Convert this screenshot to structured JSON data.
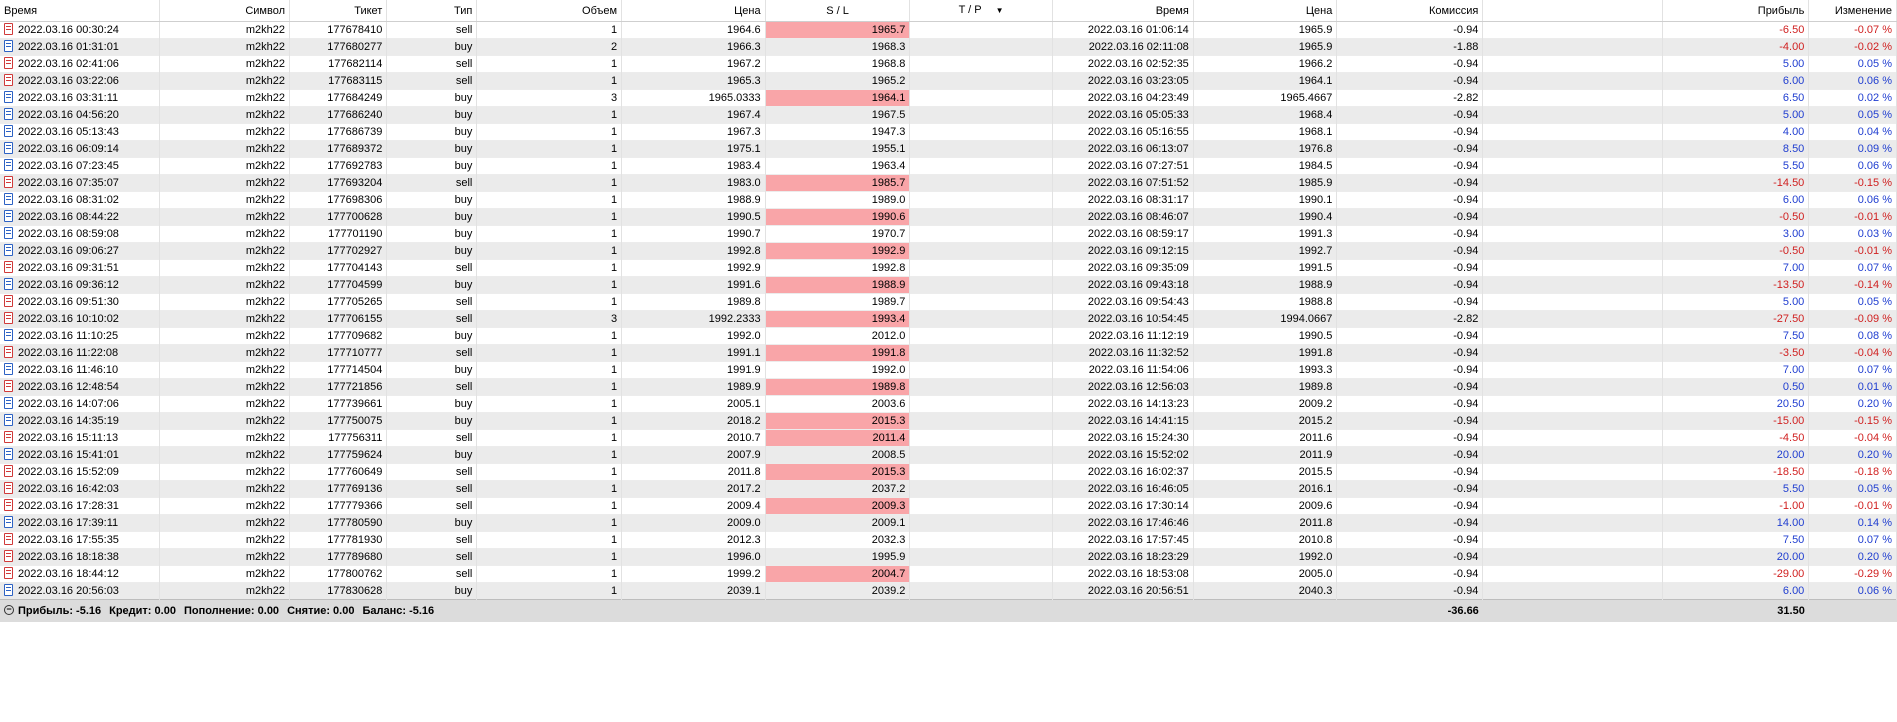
{
  "columns": [
    "Время",
    "Символ",
    "Тикет",
    "Тип",
    "Объем",
    "Цена",
    "S / L",
    "T / P",
    "Время",
    "Цена",
    "Комиссия",
    "",
    "Прибыль",
    "Изменение"
  ],
  "tp_sort_icon": "▼",
  "rows": [
    {
      "open_time": "2022.03.16 00:30:24",
      "symbol": "m2kh22",
      "ticket": "177678410",
      "type": "sell",
      "volume": "1",
      "price": "1964.6",
      "sl": "1965.7",
      "sl_hl": true,
      "tp": "",
      "close_time": "2022.03.16 01:06:14",
      "close_price": "1965.9",
      "commission": "-0.94",
      "profit": "-6.50",
      "change": "-0.07 %"
    },
    {
      "open_time": "2022.03.16 01:31:01",
      "symbol": "m2kh22",
      "ticket": "177680277",
      "type": "buy",
      "volume": "2",
      "price": "1966.3",
      "sl": "1968.3",
      "sl_hl": false,
      "tp": "",
      "close_time": "2022.03.16 02:11:08",
      "close_price": "1965.9",
      "commission": "-1.88",
      "profit": "-4.00",
      "change": "-0.02 %"
    },
    {
      "open_time": "2022.03.16 02:41:06",
      "symbol": "m2kh22",
      "ticket": "177682114",
      "type": "sell",
      "volume": "1",
      "price": "1967.2",
      "sl": "1968.8",
      "sl_hl": false,
      "tp": "",
      "close_time": "2022.03.16 02:52:35",
      "close_price": "1966.2",
      "commission": "-0.94",
      "profit": "5.00",
      "change": "0.05 %"
    },
    {
      "open_time": "2022.03.16 03:22:06",
      "symbol": "m2kh22",
      "ticket": "177683115",
      "type": "sell",
      "volume": "1",
      "price": "1965.3",
      "sl": "1965.2",
      "sl_hl": false,
      "tp": "",
      "close_time": "2022.03.16 03:23:05",
      "close_price": "1964.1",
      "commission": "-0.94",
      "profit": "6.00",
      "change": "0.06 %"
    },
    {
      "open_time": "2022.03.16 03:31:11",
      "symbol": "m2kh22",
      "ticket": "177684249",
      "type": "buy",
      "volume": "3",
      "price": "1965.0333",
      "sl": "1964.1",
      "sl_hl": true,
      "tp": "",
      "close_time": "2022.03.16 04:23:49",
      "close_price": "1965.4667",
      "commission": "-2.82",
      "profit": "6.50",
      "change": "0.02 %"
    },
    {
      "open_time": "2022.03.16 04:56:20",
      "symbol": "m2kh22",
      "ticket": "177686240",
      "type": "buy",
      "volume": "1",
      "price": "1967.4",
      "sl": "1967.5",
      "sl_hl": false,
      "tp": "",
      "close_time": "2022.03.16 05:05:33",
      "close_price": "1968.4",
      "commission": "-0.94",
      "profit": "5.00",
      "change": "0.05 %"
    },
    {
      "open_time": "2022.03.16 05:13:43",
      "symbol": "m2kh22",
      "ticket": "177686739",
      "type": "buy",
      "volume": "1",
      "price": "1967.3",
      "sl": "1947.3",
      "sl_hl": false,
      "tp": "",
      "close_time": "2022.03.16 05:16:55",
      "close_price": "1968.1",
      "commission": "-0.94",
      "profit": "4.00",
      "change": "0.04 %"
    },
    {
      "open_time": "2022.03.16 06:09:14",
      "symbol": "m2kh22",
      "ticket": "177689372",
      "type": "buy",
      "volume": "1",
      "price": "1975.1",
      "sl": "1955.1",
      "sl_hl": false,
      "tp": "",
      "close_time": "2022.03.16 06:13:07",
      "close_price": "1976.8",
      "commission": "-0.94",
      "profit": "8.50",
      "change": "0.09 %"
    },
    {
      "open_time": "2022.03.16 07:23:45",
      "symbol": "m2kh22",
      "ticket": "177692783",
      "type": "buy",
      "volume": "1",
      "price": "1983.4",
      "sl": "1963.4",
      "sl_hl": false,
      "tp": "",
      "close_time": "2022.03.16 07:27:51",
      "close_price": "1984.5",
      "commission": "-0.94",
      "profit": "5.50",
      "change": "0.06 %"
    },
    {
      "open_time": "2022.03.16 07:35:07",
      "symbol": "m2kh22",
      "ticket": "177693204",
      "type": "sell",
      "volume": "1",
      "price": "1983.0",
      "sl": "1985.7",
      "sl_hl": true,
      "tp": "",
      "close_time": "2022.03.16 07:51:52",
      "close_price": "1985.9",
      "commission": "-0.94",
      "profit": "-14.50",
      "change": "-0.15 %"
    },
    {
      "open_time": "2022.03.16 08:31:02",
      "symbol": "m2kh22",
      "ticket": "177698306",
      "type": "buy",
      "volume": "1",
      "price": "1988.9",
      "sl": "1989.0",
      "sl_hl": false,
      "tp": "",
      "close_time": "2022.03.16 08:31:17",
      "close_price": "1990.1",
      "commission": "-0.94",
      "profit": "6.00",
      "change": "0.06 %"
    },
    {
      "open_time": "2022.03.16 08:44:22",
      "symbol": "m2kh22",
      "ticket": "177700628",
      "type": "buy",
      "volume": "1",
      "price": "1990.5",
      "sl": "1990.6",
      "sl_hl": true,
      "tp": "",
      "close_time": "2022.03.16 08:46:07",
      "close_price": "1990.4",
      "commission": "-0.94",
      "profit": "-0.50",
      "change": "-0.01 %"
    },
    {
      "open_time": "2022.03.16 08:59:08",
      "symbol": "m2kh22",
      "ticket": "177701190",
      "type": "buy",
      "volume": "1",
      "price": "1990.7",
      "sl": "1970.7",
      "sl_hl": false,
      "tp": "",
      "close_time": "2022.03.16 08:59:17",
      "close_price": "1991.3",
      "commission": "-0.94",
      "profit": "3.00",
      "change": "0.03 %"
    },
    {
      "open_time": "2022.03.16 09:06:27",
      "symbol": "m2kh22",
      "ticket": "177702927",
      "type": "buy",
      "volume": "1",
      "price": "1992.8",
      "sl": "1992.9",
      "sl_hl": true,
      "tp": "",
      "close_time": "2022.03.16 09:12:15",
      "close_price": "1992.7",
      "commission": "-0.94",
      "profit": "-0.50",
      "change": "-0.01 %"
    },
    {
      "open_time": "2022.03.16 09:31:51",
      "symbol": "m2kh22",
      "ticket": "177704143",
      "type": "sell",
      "volume": "1",
      "price": "1992.9",
      "sl": "1992.8",
      "sl_hl": false,
      "tp": "",
      "close_time": "2022.03.16 09:35:09",
      "close_price": "1991.5",
      "commission": "-0.94",
      "profit": "7.00",
      "change": "0.07 %"
    },
    {
      "open_time": "2022.03.16 09:36:12",
      "symbol": "m2kh22",
      "ticket": "177704599",
      "type": "buy",
      "volume": "1",
      "price": "1991.6",
      "sl": "1988.9",
      "sl_hl": true,
      "tp": "",
      "close_time": "2022.03.16 09:43:18",
      "close_price": "1988.9",
      "commission": "-0.94",
      "profit": "-13.50",
      "change": "-0.14 %"
    },
    {
      "open_time": "2022.03.16 09:51:30",
      "symbol": "m2kh22",
      "ticket": "177705265",
      "type": "sell",
      "volume": "1",
      "price": "1989.8",
      "sl": "1989.7",
      "sl_hl": false,
      "tp": "",
      "close_time": "2022.03.16 09:54:43",
      "close_price": "1988.8",
      "commission": "-0.94",
      "profit": "5.00",
      "change": "0.05 %"
    },
    {
      "open_time": "2022.03.16 10:10:02",
      "symbol": "m2kh22",
      "ticket": "177706155",
      "type": "sell",
      "volume": "3",
      "price": "1992.2333",
      "sl": "1993.4",
      "sl_hl": true,
      "tp": "",
      "close_time": "2022.03.16 10:54:45",
      "close_price": "1994.0667",
      "commission": "-2.82",
      "profit": "-27.50",
      "change": "-0.09 %"
    },
    {
      "open_time": "2022.03.16 11:10:25",
      "symbol": "m2kh22",
      "ticket": "177709682",
      "type": "buy",
      "volume": "1",
      "price": "1992.0",
      "sl": "2012.0",
      "sl_hl": false,
      "tp": "",
      "close_time": "2022.03.16 11:12:19",
      "close_price": "1990.5",
      "commission": "-0.94",
      "profit": "7.50",
      "change": "0.08 %"
    },
    {
      "open_time": "2022.03.16 11:22:08",
      "symbol": "m2kh22",
      "ticket": "177710777",
      "type": "sell",
      "volume": "1",
      "price": "1991.1",
      "sl": "1991.8",
      "sl_hl": true,
      "tp": "",
      "close_time": "2022.03.16 11:32:52",
      "close_price": "1991.8",
      "commission": "-0.94",
      "profit": "-3.50",
      "change": "-0.04 %"
    },
    {
      "open_time": "2022.03.16 11:46:10",
      "symbol": "m2kh22",
      "ticket": "177714504",
      "type": "buy",
      "volume": "1",
      "price": "1991.9",
      "sl": "1992.0",
      "sl_hl": false,
      "tp": "",
      "close_time": "2022.03.16 11:54:06",
      "close_price": "1993.3",
      "commission": "-0.94",
      "profit": "7.00",
      "change": "0.07 %"
    },
    {
      "open_time": "2022.03.16 12:48:54",
      "symbol": "m2kh22",
      "ticket": "177721856",
      "type": "sell",
      "volume": "1",
      "price": "1989.9",
      "sl": "1989.8",
      "sl_hl": true,
      "tp": "",
      "close_time": "2022.03.16 12:56:03",
      "close_price": "1989.8",
      "commission": "-0.94",
      "profit": "0.50",
      "change": "0.01 %"
    },
    {
      "open_time": "2022.03.16 14:07:06",
      "symbol": "m2kh22",
      "ticket": "177739661",
      "type": "buy",
      "volume": "1",
      "price": "2005.1",
      "sl": "2003.6",
      "sl_hl": false,
      "tp": "",
      "close_time": "2022.03.16 14:13:23",
      "close_price": "2009.2",
      "commission": "-0.94",
      "profit": "20.50",
      "change": "0.20 %"
    },
    {
      "open_time": "2022.03.16 14:35:19",
      "symbol": "m2kh22",
      "ticket": "177750075",
      "type": "buy",
      "volume": "1",
      "price": "2018.2",
      "sl": "2015.3",
      "sl_hl": true,
      "tp": "",
      "close_time": "2022.03.16 14:41:15",
      "close_price": "2015.2",
      "commission": "-0.94",
      "profit": "-15.00",
      "change": "-0.15 %"
    },
    {
      "open_time": "2022.03.16 15:11:13",
      "symbol": "m2kh22",
      "ticket": "177756311",
      "type": "sell",
      "volume": "1",
      "price": "2010.7",
      "sl": "2011.4",
      "sl_hl": true,
      "tp": "",
      "close_time": "2022.03.16 15:24:30",
      "close_price": "2011.6",
      "commission": "-0.94",
      "profit": "-4.50",
      "change": "-0.04 %"
    },
    {
      "open_time": "2022.03.16 15:41:01",
      "symbol": "m2kh22",
      "ticket": "177759624",
      "type": "buy",
      "volume": "1",
      "price": "2007.9",
      "sl": "2008.5",
      "sl_hl": false,
      "tp": "",
      "close_time": "2022.03.16 15:52:02",
      "close_price": "2011.9",
      "commission": "-0.94",
      "profit": "20.00",
      "change": "0.20 %"
    },
    {
      "open_time": "2022.03.16 15:52:09",
      "symbol": "m2kh22",
      "ticket": "177760649",
      "type": "sell",
      "volume": "1",
      "price": "2011.8",
      "sl": "2015.3",
      "sl_hl": true,
      "tp": "",
      "close_time": "2022.03.16 16:02:37",
      "close_price": "2015.5",
      "commission": "-0.94",
      "profit": "-18.50",
      "change": "-0.18 %"
    },
    {
      "open_time": "2022.03.16 16:42:03",
      "symbol": "m2kh22",
      "ticket": "177769136",
      "type": "sell",
      "volume": "1",
      "price": "2017.2",
      "sl": "2037.2",
      "sl_hl": false,
      "tp": "",
      "close_time": "2022.03.16 16:46:05",
      "close_price": "2016.1",
      "commission": "-0.94",
      "profit": "5.50",
      "change": "0.05 %"
    },
    {
      "open_time": "2022.03.16 17:28:31",
      "symbol": "m2kh22",
      "ticket": "177779366",
      "type": "sell",
      "volume": "1",
      "price": "2009.4",
      "sl": "2009.3",
      "sl_hl": true,
      "tp": "",
      "close_time": "2022.03.16 17:30:14",
      "close_price": "2009.6",
      "commission": "-0.94",
      "profit": "-1.00",
      "change": "-0.01 %"
    },
    {
      "open_time": "2022.03.16 17:39:11",
      "symbol": "m2kh22",
      "ticket": "177780590",
      "type": "buy",
      "volume": "1",
      "price": "2009.0",
      "sl": "2009.1",
      "sl_hl": false,
      "tp": "",
      "close_time": "2022.03.16 17:46:46",
      "close_price": "2011.8",
      "commission": "-0.94",
      "profit": "14.00",
      "change": "0.14 %"
    },
    {
      "open_time": "2022.03.16 17:55:35",
      "symbol": "m2kh22",
      "ticket": "177781930",
      "type": "sell",
      "volume": "1",
      "price": "2012.3",
      "sl": "2032.3",
      "sl_hl": false,
      "tp": "",
      "close_time": "2022.03.16 17:57:45",
      "close_price": "2010.8",
      "commission": "-0.94",
      "profit": "7.50",
      "change": "0.07 %"
    },
    {
      "open_time": "2022.03.16 18:18:38",
      "symbol": "m2kh22",
      "ticket": "177789680",
      "type": "sell",
      "volume": "1",
      "price": "1996.0",
      "sl": "1995.9",
      "sl_hl": false,
      "tp": "",
      "close_time": "2022.03.16 18:23:29",
      "close_price": "1992.0",
      "commission": "-0.94",
      "profit": "20.00",
      "change": "0.20 %"
    },
    {
      "open_time": "2022.03.16 18:44:12",
      "symbol": "m2kh22",
      "ticket": "177800762",
      "type": "sell",
      "volume": "1",
      "price": "1999.2",
      "sl": "2004.7",
      "sl_hl": true,
      "tp": "",
      "close_time": "2022.03.16 18:53:08",
      "close_price": "2005.0",
      "commission": "-0.94",
      "profit": "-29.00",
      "change": "-0.29 %"
    },
    {
      "open_time": "2022.03.16 20:56:03",
      "symbol": "m2kh22",
      "ticket": "177830628",
      "type": "buy",
      "volume": "1",
      "price": "2039.1",
      "sl": "2039.2",
      "sl_hl": false,
      "tp": "",
      "close_time": "2022.03.16 20:56:51",
      "close_price": "2040.3",
      "commission": "-0.94",
      "profit": "6.00",
      "change": "0.06 %"
    }
  ],
  "summary": {
    "collapse_icon": "−",
    "profit": "Прибыль: -5.16",
    "credit": "Кредит: 0.00",
    "deposit": "Пополнение: 0.00",
    "withdrawal": "Снятие: 0.00",
    "balance": "Баланс: -5.16",
    "commission_total": "-36.66",
    "profit_total": "31.50"
  },
  "colors": {
    "sl_highlight": "#f9a5a8",
    "positive": "#1f3dd0",
    "negative": "#d01f1f",
    "sell_icon": "#d03a3a",
    "buy_icon": "#2d62c4"
  }
}
